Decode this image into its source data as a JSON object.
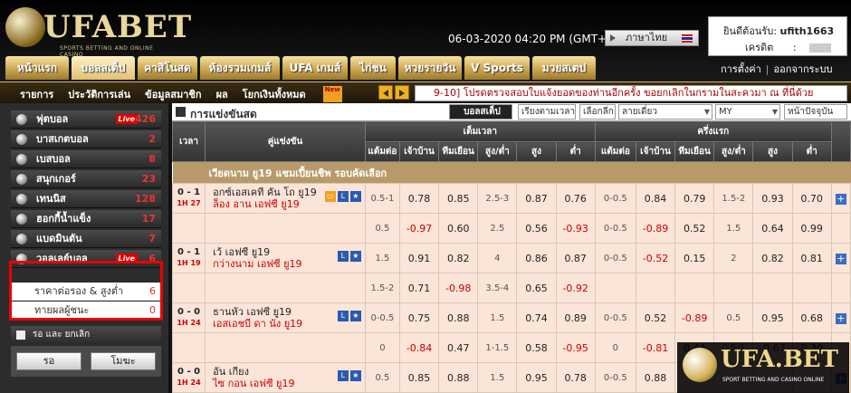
{
  "header": {
    "logo_text": "UFABET",
    "logo_tagline": "SPORTS BETTING AND ONLINE CASINO",
    "datetime": "06-03-2020 04:20 PM (GMT+8)",
    "language": "ภาษาไทย",
    "account_label": "ยินดีต้อนรับ:",
    "account_user": "ufith1663",
    "credit_label": "เครดิต",
    "credit_sep": ":",
    "settings_link": "การตั้งค่า",
    "logout_link": "ออกจากระบบ",
    "link_sep": "|",
    "tabs": [
      {
        "label": "หน้าแรก",
        "w": 70,
        "active": false
      },
      {
        "label": "บอลสเต็ป",
        "w": 70,
        "active": true
      },
      {
        "label": "คาสิโนสด",
        "w": 66,
        "active": false
      },
      {
        "label": "ห้องรวมเกมส์",
        "w": 88,
        "active": false
      },
      {
        "label": "UFA เกมส์",
        "w": 72,
        "active": false
      },
      {
        "label": "ไก่ชน",
        "w": 50,
        "active": false
      },
      {
        "label": "หวยรายวัน",
        "w": 70,
        "active": false
      },
      {
        "label": "V Sports",
        "w": 72,
        "active": false
      },
      {
        "label": "มวยสเตป",
        "w": 70,
        "active": false
      }
    ]
  },
  "subnav": {
    "items": [
      "รายการ",
      "ประวัติการเล่น",
      "ข้อมูลสมาชิก",
      "ผล",
      "โยกเงินทั้งหมด"
    ],
    "new_badge": "New",
    "ticker": "9-10] โปรดตรวจสอบใบแจ้งยอดของท่านอีกครั้ง ขอยกเลิกในกรามในสะควมา ณ ที่นี่ด้วย"
  },
  "sidebar": {
    "sports": [
      {
        "label": "ฟุตบอล",
        "count": "426",
        "live": true
      },
      {
        "label": "บาสเกตบอล",
        "count": "2",
        "live": false
      },
      {
        "label": "เบสบอล",
        "count": "8",
        "live": false
      },
      {
        "label": "สนุกเกอร์",
        "count": "23",
        "live": false
      },
      {
        "label": "เทนนิส",
        "count": "128",
        "live": false
      },
      {
        "label": "ฮอกกี้น้ำแข็ง",
        "count": "17",
        "live": false
      },
      {
        "label": "แบดมินตัน",
        "count": "7",
        "live": false
      },
      {
        "label": "วอลเลย์บอล",
        "count": "6",
        "live": true
      }
    ],
    "live_label": "Live",
    "subs": [
      {
        "label": "ราคาต่อรอง & สูงต่ำ",
        "count": "6"
      },
      {
        "label": "ทายผลผู้ชนะ",
        "count": "0"
      }
    ],
    "bottom_label": "รอ และ ยกเลิก",
    "btn_wait": "รอ",
    "btn_promo": "โมฆะ"
  },
  "main": {
    "title": "การแข่งขันสด",
    "controls": {
      "sport": "บอลสเต็ป",
      "sort": "เรียงตามเวลา",
      "league": "เลือกลีก",
      "odds": "ลายเดี่ยว",
      "market": "MY",
      "today": "หน้าปัจจุบัน"
    },
    "headers": {
      "time": "เวลา",
      "match": "คู่แข่งขัน",
      "full": "เต็มเวลา",
      "half": "ครึ่งแรก",
      "cols": [
        "แต้มต่อ",
        "เจ้าบ้าน",
        "ทีมเยือน",
        "สูง/ต่ำ",
        "สูง",
        "ต่ำ"
      ]
    },
    "league": "เวียดนาม ยู19 แชมเปี้ยนชิพ รอบคัดเลือก",
    "rows": [
      {
        "score": "0 - 1",
        "time": "1H 27",
        "home": "อกซ์เอสเคที คัน โถ ยู19",
        "away": "ล็อง อาน เอฟซี ยู19",
        "tv": true,
        "f": [
          "0.5-1",
          "0.78",
          "0.85",
          "2.5-3",
          "0.87",
          "0.76"
        ],
        "h": [
          "0-0.5",
          "0.84",
          "0.79",
          "1.5-2",
          "0.93",
          "0.70"
        ]
      },
      {
        "score": "",
        "time": "",
        "home": "",
        "away": "",
        "tv": false,
        "f": [
          "0.5",
          "-0.97",
          "0.60",
          "2.5",
          "0.56",
          "-0.93"
        ],
        "h": [
          "0-0.5",
          "-0.89",
          "0.52",
          "1.5",
          "0.64",
          "0.99"
        ]
      },
      {
        "score": "0 - 1",
        "time": "1H 19",
        "home": "เว้ เอฟซี ยู19",
        "away": "กว่างนาม เอฟซี ยู19",
        "tv": false,
        "f": [
          "1.5",
          "0.91",
          "0.82",
          "4",
          "0.86",
          "0.87"
        ],
        "h": [
          "0-0.5",
          "-0.52",
          "0.15",
          "2",
          "0.82",
          "0.81"
        ]
      },
      {
        "score": "",
        "time": "",
        "home": "",
        "away": "",
        "tv": false,
        "f": [
          "1.5-2",
          "0.71",
          "-0.98",
          "3.5-4",
          "0.65",
          "-0.92"
        ],
        "h": [
          "",
          "",
          "",
          "",
          "",
          ""
        ]
      },
      {
        "score": "0 - 0",
        "time": "1H 24",
        "home": "ธานหัว เอฟซี ยู19",
        "away": "เอสเอชบี ดา นัง ยู19",
        "tv": false,
        "f": [
          "0-0.5",
          "0.75",
          "0.88",
          "1.5",
          "0.74",
          "0.89"
        ],
        "h": [
          "0-0.5",
          "0.52",
          "-0.89",
          "0.5",
          "0.95",
          "0.68"
        ]
      },
      {
        "score": "",
        "time": "",
        "home": "",
        "away": "",
        "tv": false,
        "f": [
          "0",
          "-0.84",
          "0.47",
          "1-1.5",
          "0.58",
          "-0.95"
        ],
        "h": [
          "0",
          "-0.81",
          "0.44",
          "0.5-1",
          "-0.67",
          "0.30"
        ]
      },
      {
        "score": "0 - 0",
        "time": "1H 24",
        "home": "อัน เกียง",
        "away": "ไซ กอน เอฟซี ยู19",
        "tv": false,
        "f": [
          "0.5",
          "0.85",
          "0.88",
          "1.5",
          "0.95",
          "0.78"
        ],
        "h": [
          "0-0.5",
          "0.88",
          "",
          "",
          "",
          ""
        ]
      }
    ]
  },
  "watermark": {
    "text": "UFA.BET",
    "tag": "SPORT BETTING AND CASINO ONLINE"
  }
}
